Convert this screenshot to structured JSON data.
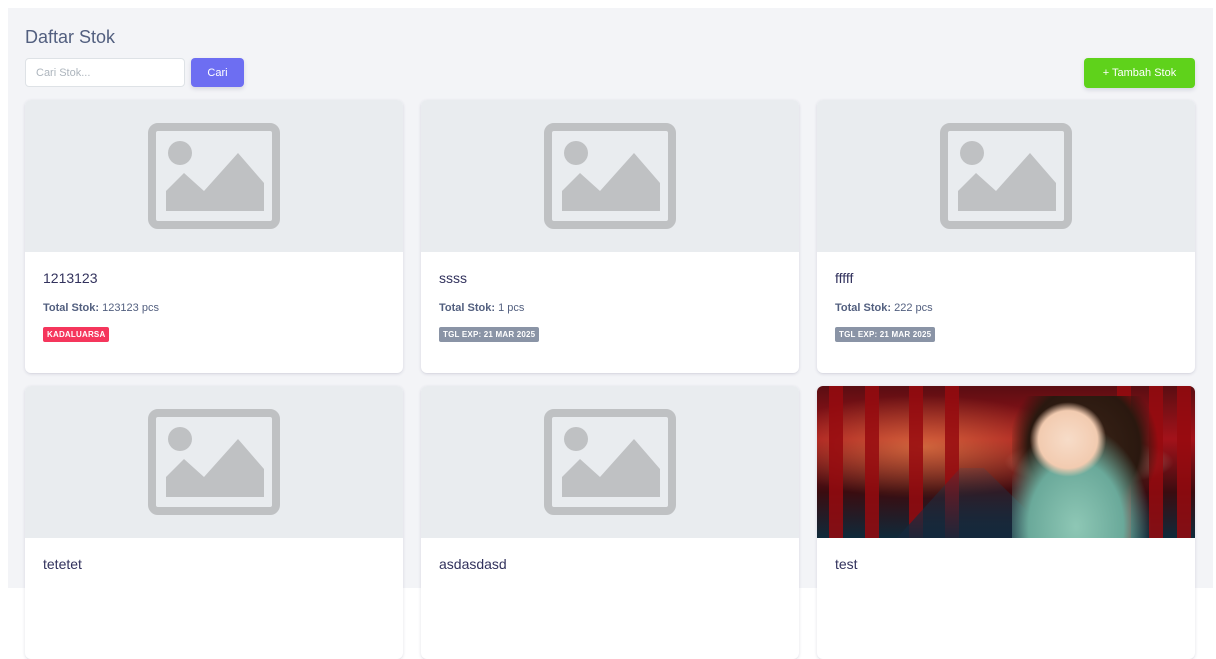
{
  "header": {
    "title": "Daftar Stok",
    "search_placeholder": "Cari Stok...",
    "search_button": "Cari",
    "add_button": "+ Tambah Stok"
  },
  "colors": {
    "primary": "#6d6ef2",
    "success": "#5fd21b",
    "danger": "#f5365c",
    "secondary": "#8a94a6",
    "background": "#f3f4f7"
  },
  "stock_label": "Total Stok:",
  "items": [
    {
      "name": "1213123",
      "total": "123123 pcs",
      "badge": "KADALUARSA",
      "badge_type": "danger",
      "image": "placeholder-image-icon"
    },
    {
      "name": "ssss",
      "total": "1 pcs",
      "badge": "TGL EXP: 21 MAR 2025",
      "badge_type": "secondary",
      "image": "placeholder-image-icon"
    },
    {
      "name": "fffff",
      "total": "222 pcs",
      "badge": "TGL EXP: 21 MAR 2025",
      "badge_type": "secondary",
      "image": "placeholder-image-icon"
    },
    {
      "name": "tetetet",
      "image": "placeholder-image-icon"
    },
    {
      "name": "asdasdasd",
      "image": "placeholder-image-icon"
    },
    {
      "name": "test",
      "image": "photo"
    }
  ]
}
